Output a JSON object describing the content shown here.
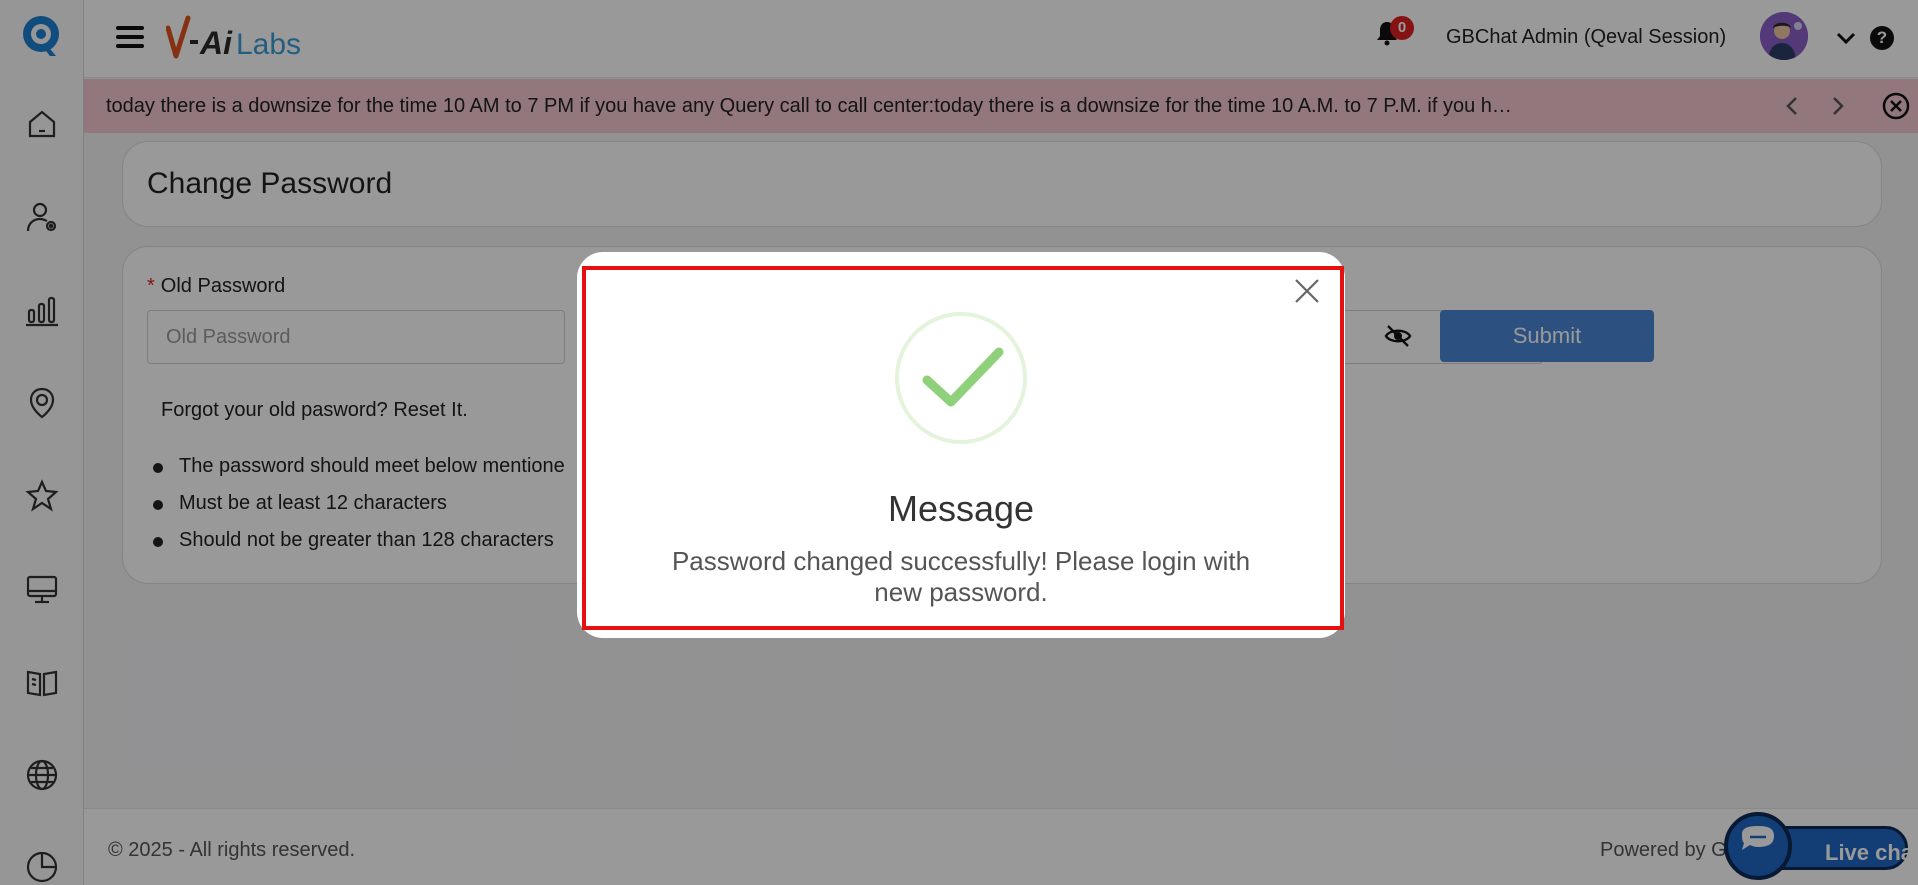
{
  "header": {
    "brand": "V-AiLabs",
    "notification_count": "0",
    "user_name": "GBChat Admin (Qeval Session)",
    "help_label": "?"
  },
  "sidebar": {
    "items": [
      {
        "icon": "home-icon"
      },
      {
        "icon": "user-settings-icon"
      },
      {
        "icon": "bar-chart-icon"
      },
      {
        "icon": "badge-icon"
      },
      {
        "icon": "star-icon"
      },
      {
        "icon": "monitor-icon"
      },
      {
        "icon": "book-icon"
      },
      {
        "icon": "globe-icon"
      },
      {
        "icon": "pie-chart-icon"
      }
    ]
  },
  "announcement": {
    "text": "today there is a downsize for the time 10 AM to 7 PM if you have any Query call to call center:today there is a downsize for the time 10 A.M. to 7 P.M. if you h…"
  },
  "page": {
    "title": "Change Password",
    "old_password_label": "Old Password",
    "required_mark": "*",
    "old_password_placeholder": "Old Password",
    "submit_label": "Submit",
    "forgot_text": "Forgot your old pasword? Reset It.",
    "rules": [
      "The password should meet below mentione",
      "Must be at least 12 characters",
      "Should not be greater than 128 characters"
    ]
  },
  "footer": {
    "copyright": "© 2025 - All rights reserved.",
    "powered_by": "Powered by G"
  },
  "livechat": {
    "label": "Live chat"
  },
  "modal": {
    "title": "Message",
    "message": "Password changed successfully! Please login with new password."
  },
  "colors": {
    "announcement_bg": "#f3c7cf",
    "submit_bg": "#4a86d6",
    "success_check": "#8fd17a",
    "highlight_frame": "#e51010"
  }
}
